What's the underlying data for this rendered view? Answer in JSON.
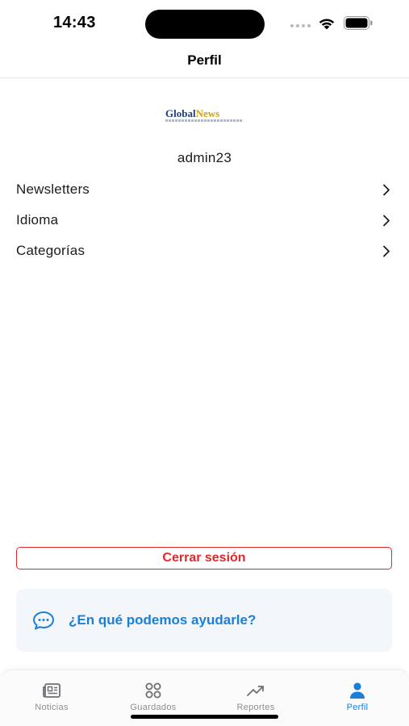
{
  "status_bar": {
    "time": "14:43"
  },
  "header": {
    "title": "Perfil"
  },
  "profile": {
    "logo": {
      "part1": "Global",
      "part2": "News"
    },
    "username": "admin23"
  },
  "menu": {
    "items": [
      {
        "label": "Newsletters",
        "icon": "chevron-right-icon"
      },
      {
        "label": "Idioma",
        "icon": "chevron-right-icon"
      },
      {
        "label": "Categorías",
        "icon": "chevron-right-icon"
      }
    ]
  },
  "logout": {
    "label": "Cerrar sesión"
  },
  "help": {
    "label": "¿En qué podemos ayudarle?",
    "icon": "chat-bubble-icon"
  },
  "tab_bar": {
    "tabs": [
      {
        "label": "Noticias",
        "icon": "newspaper-icon",
        "active": false
      },
      {
        "label": "Guardados",
        "icon": "grid-icon",
        "active": false
      },
      {
        "label": "Reportes",
        "icon": "trending-up-icon",
        "active": false
      },
      {
        "label": "Perfil",
        "icon": "person-icon",
        "active": true
      }
    ]
  },
  "colors": {
    "accent": "#1a7fd9",
    "danger": "#e8262b",
    "inactive": "#8e8e93",
    "help_background": "#f3f7fc"
  }
}
